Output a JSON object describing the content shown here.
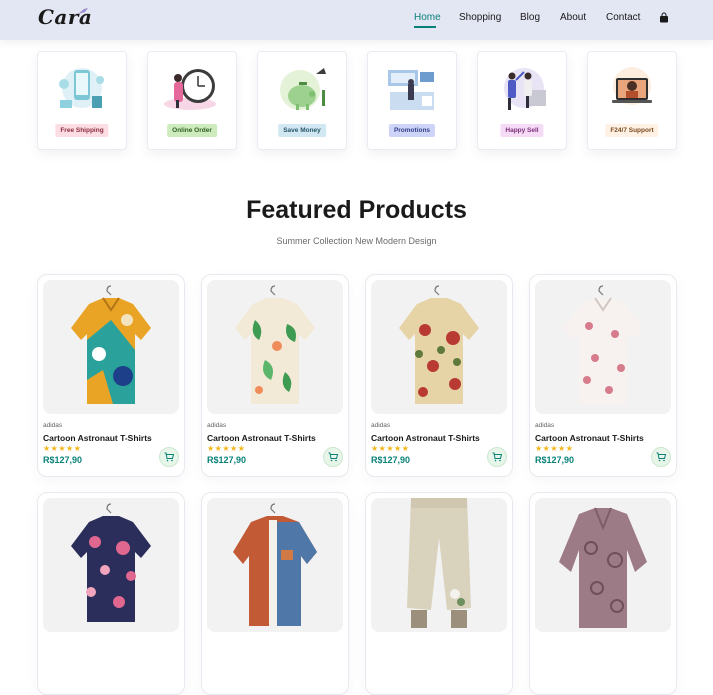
{
  "header": {
    "logo_text": "Cara",
    "nav": [
      {
        "label": "Home",
        "active": true
      },
      {
        "label": "Shopping",
        "active": false
      },
      {
        "label": "Blog",
        "active": false
      },
      {
        "label": "About",
        "active": false
      },
      {
        "label": "Contact",
        "active": false
      }
    ],
    "bag_icon": "shopping-bag-icon",
    "accent": "#088178"
  },
  "features": [
    {
      "label": "Free Shipping",
      "bg": "#fddde4"
    },
    {
      "label": "Online Order",
      "bg": "#cdebbc"
    },
    {
      "label": "Save Money",
      "bg": "#d1e8f2"
    },
    {
      "label": "Promotions",
      "bg": "#cdd4f8"
    },
    {
      "label": "Happy Sell",
      "bg": "#f6dbf6"
    },
    {
      "label": "F24/7 Support",
      "bg": "#fff2e5"
    }
  ],
  "section": {
    "title": "Featured Products",
    "subtitle": "Summer Collection New Modern Design"
  },
  "products": [
    {
      "brand": "adidas",
      "name": "Cartoon Astronaut T-Shirts",
      "stars": "★★★★★",
      "price": "R$127,90",
      "image": "shirt-teal-yellow-print"
    },
    {
      "brand": "adidas",
      "name": "Cartoon Astronaut T-Shirts",
      "stars": "★★★★★",
      "price": "R$127,90",
      "image": "shirt-cream-leaf-print"
    },
    {
      "brand": "adidas",
      "name": "Cartoon Astronaut T-Shirts",
      "stars": "★★★★★",
      "price": "R$127,90",
      "image": "shirt-beige-floral-print"
    },
    {
      "brand": "adidas",
      "name": "Cartoon Astronaut T-Shirts",
      "stars": "★★★★★",
      "price": "R$127,90",
      "image": "shirt-white-pink-print"
    },
    {
      "image": "shirt-navy-pink-floral"
    },
    {
      "image": "shirt-orange-denim"
    },
    {
      "image": "pants-linen-floral"
    },
    {
      "image": "blouse-mauve-print"
    }
  ]
}
